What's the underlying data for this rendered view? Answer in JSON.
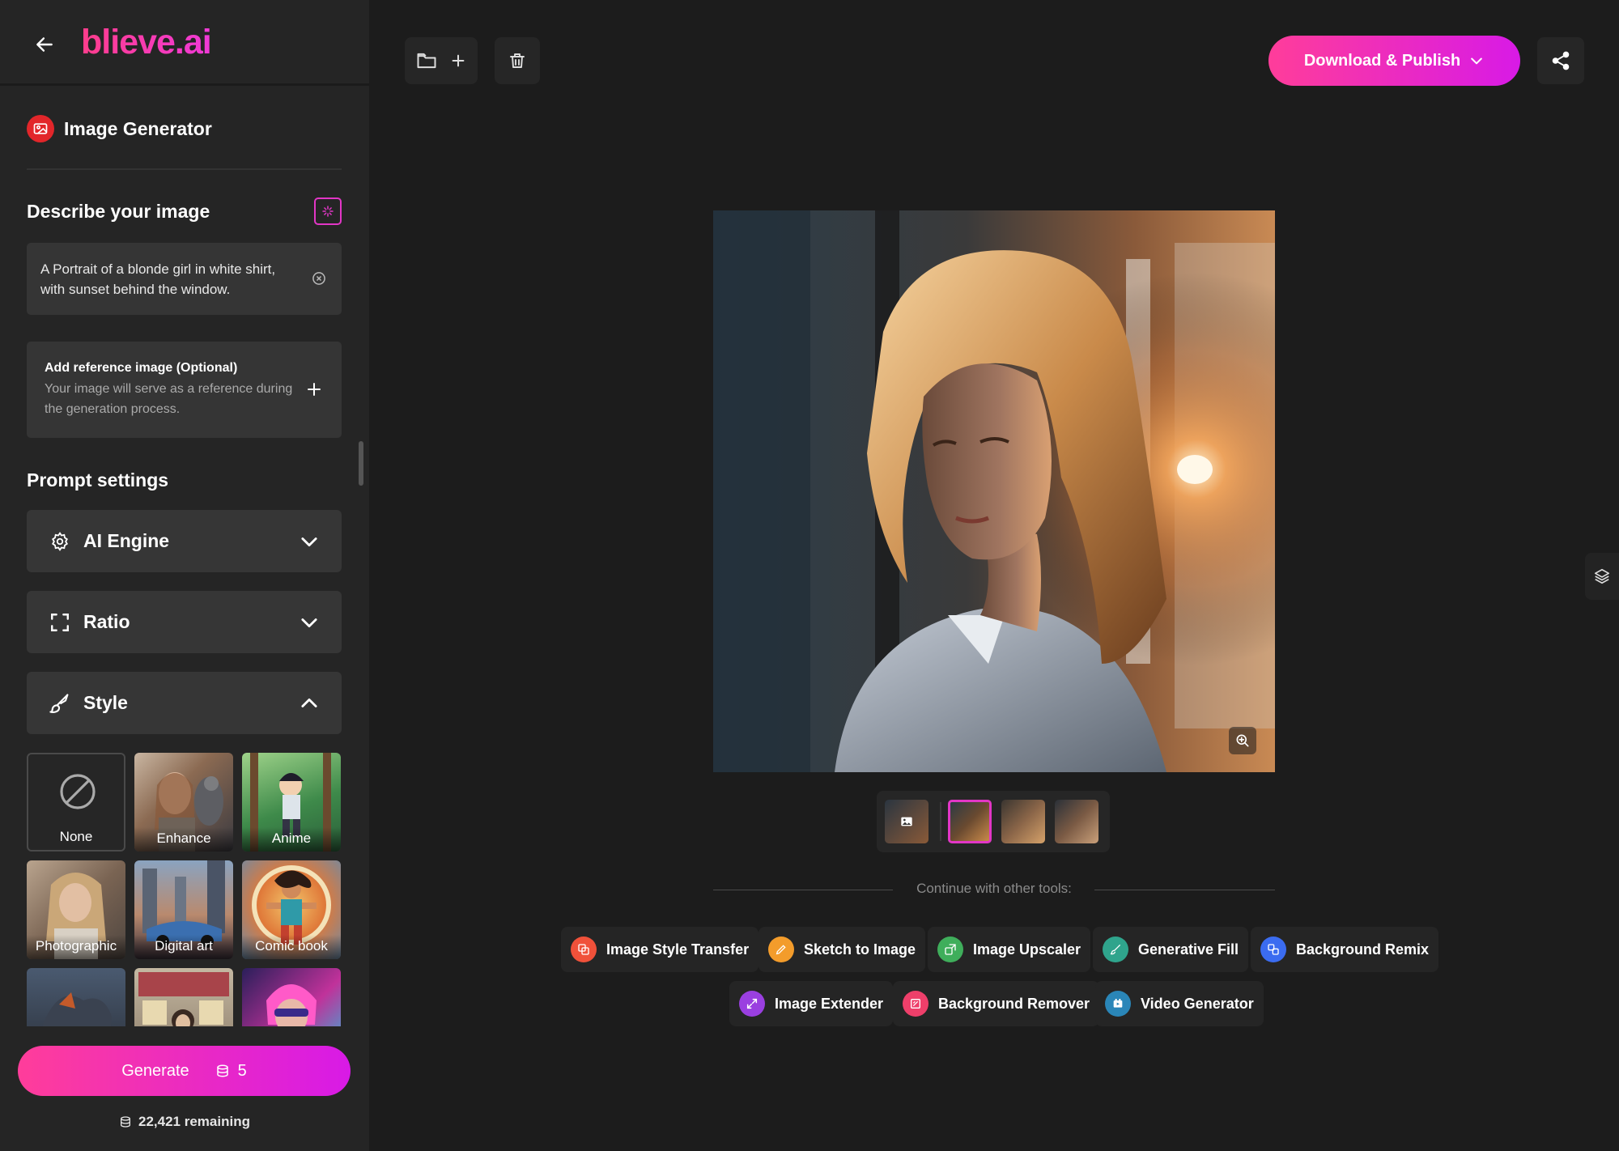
{
  "header": {
    "logo_text": "blieve.ai",
    "back_icon": "arrow-left-icon"
  },
  "sidebar": {
    "tool_name": "Image Generator",
    "describe": {
      "heading": "Describe your image",
      "prompt_value": "A Portrait of a blonde girl in white shirt, with sunset behind the window."
    },
    "reference": {
      "title": "Add reference image (Optional)",
      "description": "Your image will serve as a reference during the generation process."
    },
    "prompt_settings": {
      "heading": "Prompt settings",
      "ai_engine": "AI Engine",
      "ratio": "Ratio",
      "style": "Style"
    },
    "styles": [
      {
        "label": "None",
        "selected": true
      },
      {
        "label": "Enhance"
      },
      {
        "label": "Anime"
      },
      {
        "label": "Photographic"
      },
      {
        "label": "Digital art"
      },
      {
        "label": "Comic book"
      }
    ],
    "generate": {
      "label": "Generate",
      "cost": "5",
      "remaining": "22,421 remaining"
    }
  },
  "toolbar": {
    "download_label": "Download & Publish"
  },
  "main": {
    "thumbnails_count": 4,
    "selected_thumbnail": 2,
    "continue_text": "Continue with other tools:",
    "tools": [
      {
        "label": "Image Style Transfer",
        "color": "#f0513a"
      },
      {
        "label": "Sketch to Image",
        "color": "#f39c2b"
      },
      {
        "label": "Image Upscaler",
        "color": "#3fae5b"
      },
      {
        "label": "Generative Fill",
        "color": "#2fa48c"
      },
      {
        "label": "Background Remix",
        "color": "#3b6cf0"
      },
      {
        "label": "Image Extender",
        "color": "#9a3fe0"
      },
      {
        "label": "Background Remover",
        "color": "#ee3f6a"
      },
      {
        "label": "Video Generator",
        "color": "#2a86b8"
      }
    ]
  },
  "colors": {
    "accent_start": "#ff3d9a",
    "accent_end": "#d81ae6",
    "sidebar_bg": "#252525",
    "main_bg": "#1c1c1c"
  }
}
